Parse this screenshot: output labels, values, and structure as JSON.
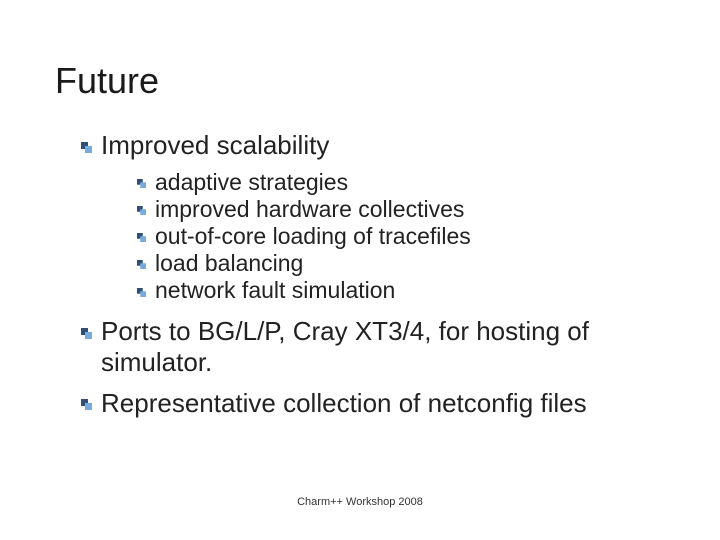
{
  "title": "Future",
  "bullets": [
    {
      "text": "Improved scalability",
      "children": [
        "adaptive strategies",
        "improved hardware collectives",
        "out-of-core loading of tracefiles",
        "load balancing",
        "network fault simulation"
      ]
    },
    {
      "text": "Ports to BG/L/P, Cray XT3/4, for hosting of simulator."
    },
    {
      "text": "Representative collection of netconfig files"
    }
  ],
  "footer": "Charm++ Workshop 2008"
}
